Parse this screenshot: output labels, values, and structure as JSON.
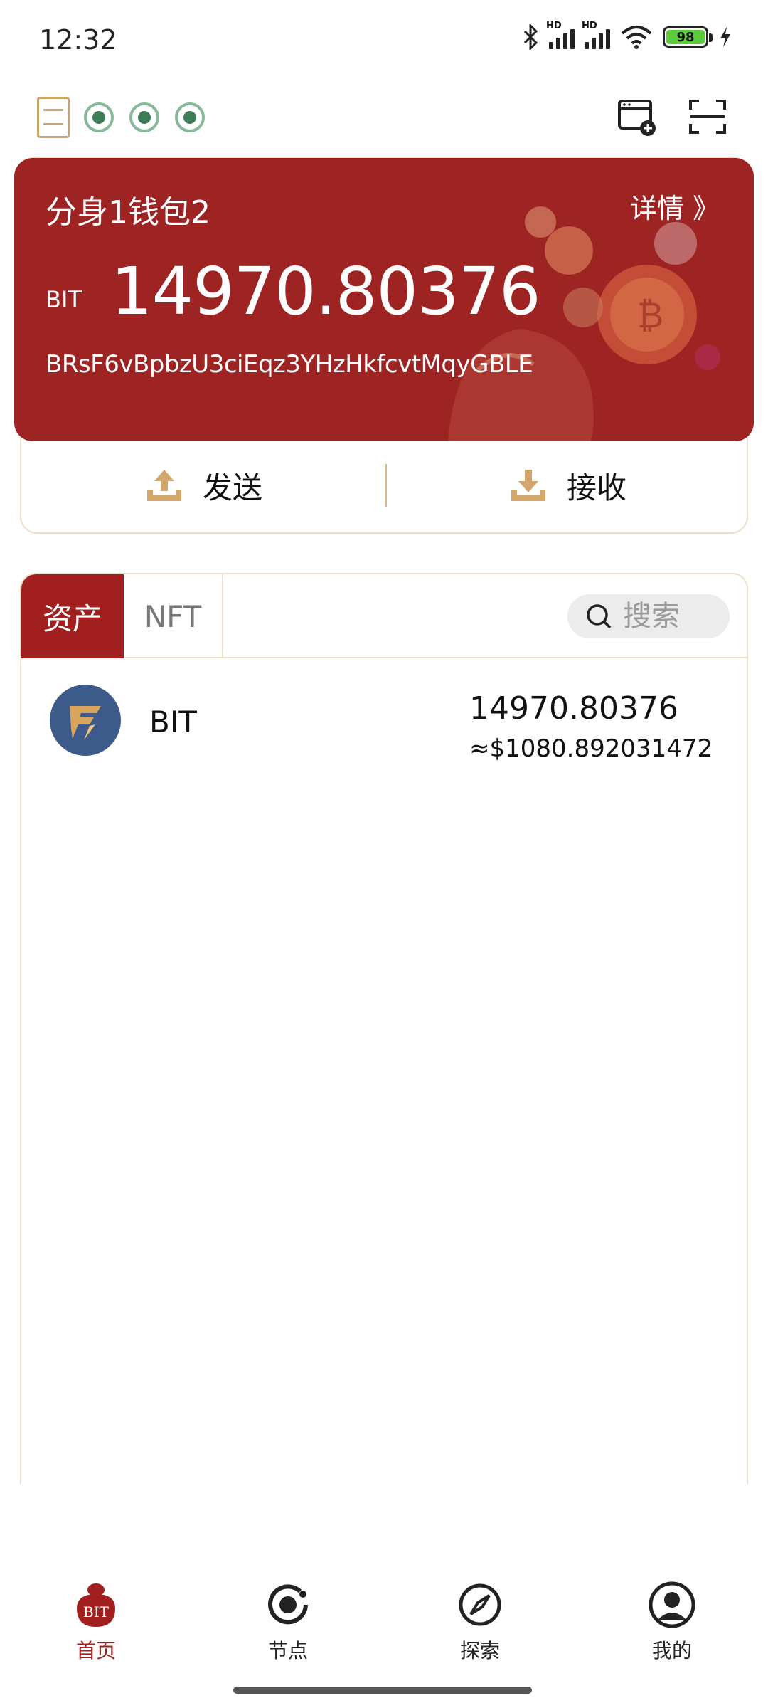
{
  "status_bar": {
    "time": "12:32",
    "signal_1": "HD",
    "signal_2": "HD",
    "battery": "98",
    "icons": [
      "bluetooth-icon",
      "signal-icon",
      "signal-icon",
      "wifi-icon",
      "battery-icon",
      "charging-icon"
    ]
  },
  "top_toolbar": {
    "icons": [
      "logo-seal",
      "node-status-icon",
      "node-status-icon",
      "node-status-icon",
      "add-browser-icon",
      "scan-icon"
    ]
  },
  "wallet": {
    "name": "分身1钱包2",
    "detail_label": "详情 》",
    "unit": "BIT",
    "amount": "14970.80376",
    "address": "BRsF6vBpbzU3ciEqz3YHzHkfcvtMqyGBLE",
    "send_label": "发送",
    "receive_label": "接收",
    "card_color": "#9e2424"
  },
  "assets": {
    "tabs": [
      {
        "label": "资产",
        "active": true
      },
      {
        "label": "NFT",
        "active": false
      }
    ],
    "search": {
      "placeholder": "搜索"
    },
    "tokens": [
      {
        "name": "BIT",
        "balance": "14970.80376",
        "fiat": "≈$1080.892031472"
      }
    ]
  },
  "bottom_nav": {
    "items": [
      {
        "label": "首页",
        "icon": "home-bit-icon",
        "active": true,
        "badge": "BIT"
      },
      {
        "label": "节点",
        "icon": "node-icon",
        "active": false
      },
      {
        "label": "探索",
        "icon": "compass-icon",
        "active": false
      },
      {
        "label": "我的",
        "icon": "user-icon",
        "active": false
      }
    ],
    "accent": "#a11f1f"
  }
}
